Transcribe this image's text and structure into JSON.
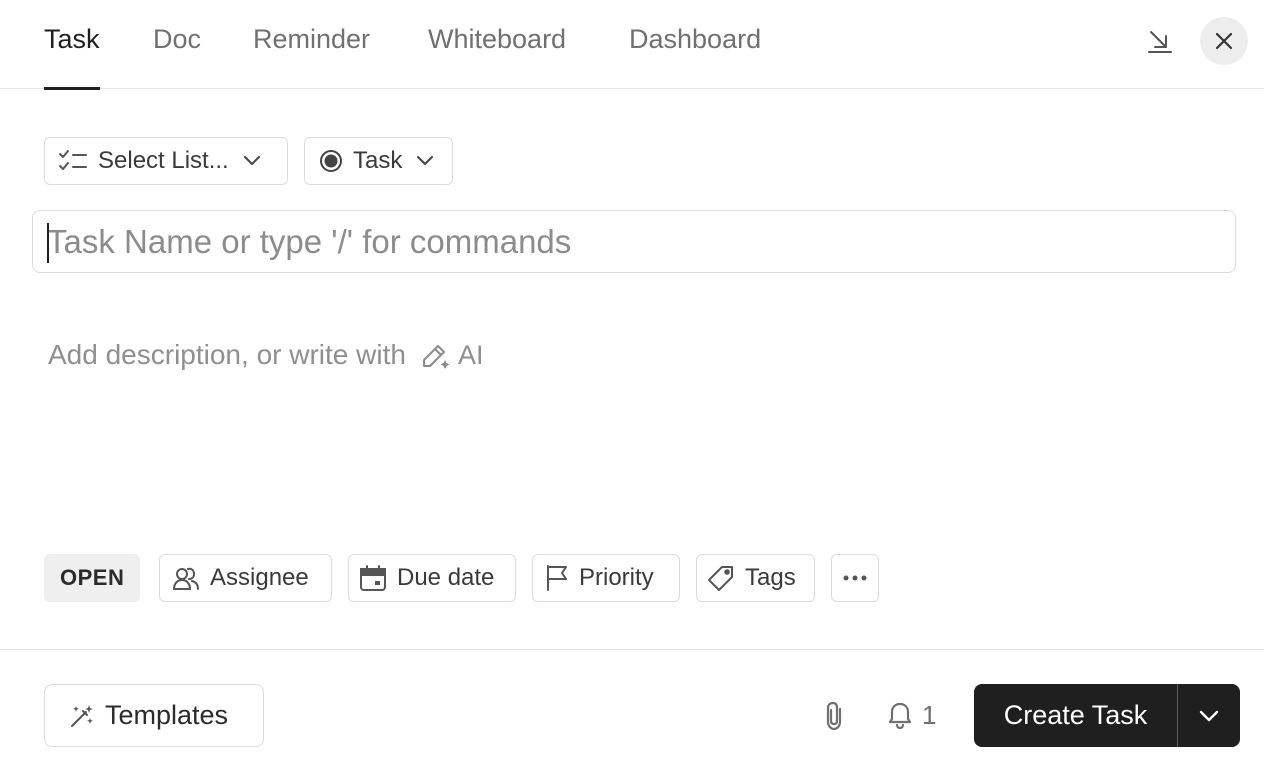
{
  "tabs": [
    {
      "label": "Task",
      "active": true
    },
    {
      "label": "Doc",
      "active": false
    },
    {
      "label": "Reminder",
      "active": false
    },
    {
      "label": "Whiteboard",
      "active": false
    },
    {
      "label": "Dashboard",
      "active": false
    }
  ],
  "header": {
    "minimize_icon": "arrow-down-right-icon",
    "close_icon": "close-icon"
  },
  "selectors": {
    "list_label": "Select List...",
    "type_label": "Task"
  },
  "task_name": {
    "value": "",
    "placeholder": "Task Name or type '/' for commands"
  },
  "description": {
    "placeholder": "Add description, or write with",
    "ai_label": "AI"
  },
  "fields": {
    "status": "OPEN",
    "assignee": "Assignee",
    "due_date": "Due date",
    "priority": "Priority",
    "tags": "Tags"
  },
  "footer": {
    "templates_label": "Templates",
    "reminder_count": "1",
    "create_label": "Create Task"
  },
  "colors": {
    "primary_button": "#1f1f1f",
    "status_bg": "#efefef"
  }
}
